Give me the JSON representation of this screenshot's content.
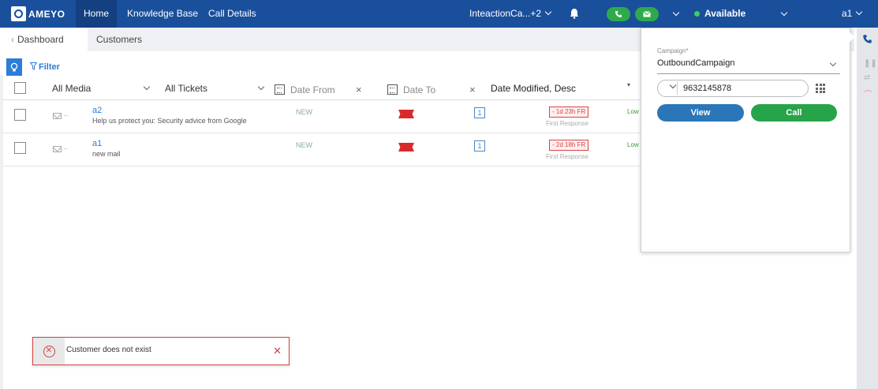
{
  "brand": {
    "logo_text": "AMEYO"
  },
  "nav": {
    "home": "Home",
    "knowledge_base": "Knowledge Base",
    "call_details": "Call Details",
    "interaction": "InteactionCa...+2",
    "status": "Available",
    "user": "a1"
  },
  "tabs": {
    "dashboard": "Dashboard",
    "customers": "Customers"
  },
  "filter": {
    "label": "Filter"
  },
  "table": {
    "media_filter": "All Media",
    "ticket_filter": "All Tickets",
    "date_from": "Date From",
    "date_to": "Date To",
    "sort": "Date Modified, Desc",
    "rows": [
      {
        "subject": "a2",
        "description": "Help us protect you: Security advice from Google",
        "state": "NEW",
        "count": "1",
        "sla": "- 1d 23h FR",
        "sla_label": "First Response",
        "priority": "Low"
      },
      {
        "subject": "a1",
        "description": "new mail",
        "state": "NEW",
        "count": "1",
        "sla": "- 2d 18h FR",
        "sla_label": "First Response",
        "priority": "Low"
      }
    ]
  },
  "panel": {
    "campaign_label": "Campaign*",
    "campaign_value": "OutboundCampaign",
    "phone": "9632145878",
    "view_label": "View",
    "call_label": "Call"
  },
  "toast": {
    "message": "Customer does not exist"
  },
  "colors": {
    "navbar": "#1a4f9c",
    "accent_blue": "#2a7dd8",
    "green": "#27a349",
    "error": "#d64040"
  }
}
